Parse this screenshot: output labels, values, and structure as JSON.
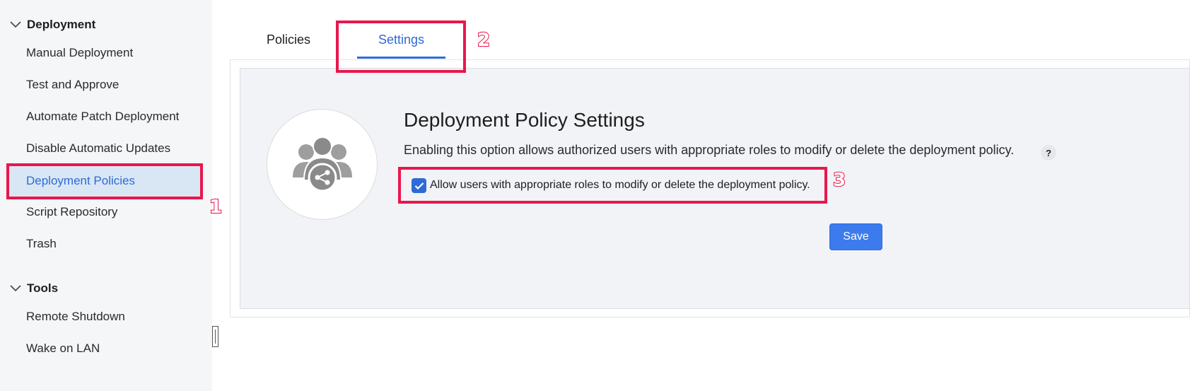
{
  "sidebar": {
    "groups": [
      {
        "label": "Deployment",
        "items": [
          {
            "label": "Manual Deployment"
          },
          {
            "label": "Test and Approve"
          },
          {
            "label": "Automate Patch Deployment"
          },
          {
            "label": "Disable Automatic Updates"
          },
          {
            "label": "Deployment Policies",
            "active": true
          },
          {
            "label": "Script Repository"
          },
          {
            "label": "Trash"
          }
        ]
      },
      {
        "label": "Tools",
        "items": [
          {
            "label": "Remote Shutdown"
          },
          {
            "label": "Wake on LAN"
          }
        ]
      }
    ]
  },
  "tabs": [
    {
      "label": "Policies",
      "active": false
    },
    {
      "label": "Settings",
      "active": true
    }
  ],
  "settings": {
    "title": "Deployment Policy Settings",
    "description": "Enabling this option allows authorized users with appropriate roles to modify or delete the deployment policy.",
    "help_glyph": "?",
    "checkbox_label": "Allow users with appropriate roles to modify or delete the deployment policy.",
    "checkbox_checked": true,
    "save_label": "Save"
  },
  "annotations": [
    "1",
    "2",
    "3"
  ],
  "colors": {
    "accent": "#2e6bd6",
    "save_button": "#3b7bed",
    "annotation": "#e8174d",
    "active_bg": "#d9e6f4"
  },
  "icons": {
    "group_toggle": "chevron-down-icon",
    "policy_avatar": "users-share-icon",
    "help": "help-icon",
    "checkbox": "check-icon"
  }
}
